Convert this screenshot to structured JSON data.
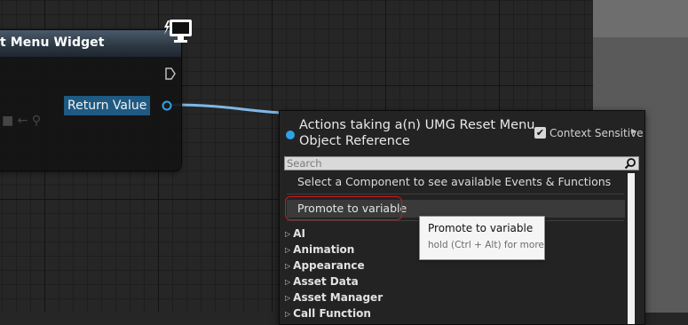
{
  "node": {
    "title": "t Menu Widget",
    "return_label": "Return Value",
    "ghost_icons": "■ ← ⚲"
  },
  "menu": {
    "title_line1": "Actions taking a(n) UMG Reset Menu",
    "title_line2": "Object Reference",
    "context_sensitive_label": "Context Sensitive",
    "context_sensitive_checked": true,
    "search_placeholder": "Search",
    "hint": "Select a Component to see available Events & Functions",
    "promote_label": "Promote to variable",
    "categories": [
      "AI",
      "Animation",
      "Appearance",
      "Asset Data",
      "Asset Manager",
      "Call Function"
    ]
  },
  "tooltip": {
    "title": "Promote to variable",
    "subtitle": "hold (Ctrl + Alt) for more"
  },
  "colors": {
    "pin_blue": "#2fa3e6",
    "wire": "#7fb7e6",
    "highlight_red": "#d01818"
  },
  "icons": {
    "monitor": "monitor-icon",
    "exec_pin": "exec-pin-icon",
    "object_pin": "object-pin-icon",
    "search": "search-icon"
  }
}
